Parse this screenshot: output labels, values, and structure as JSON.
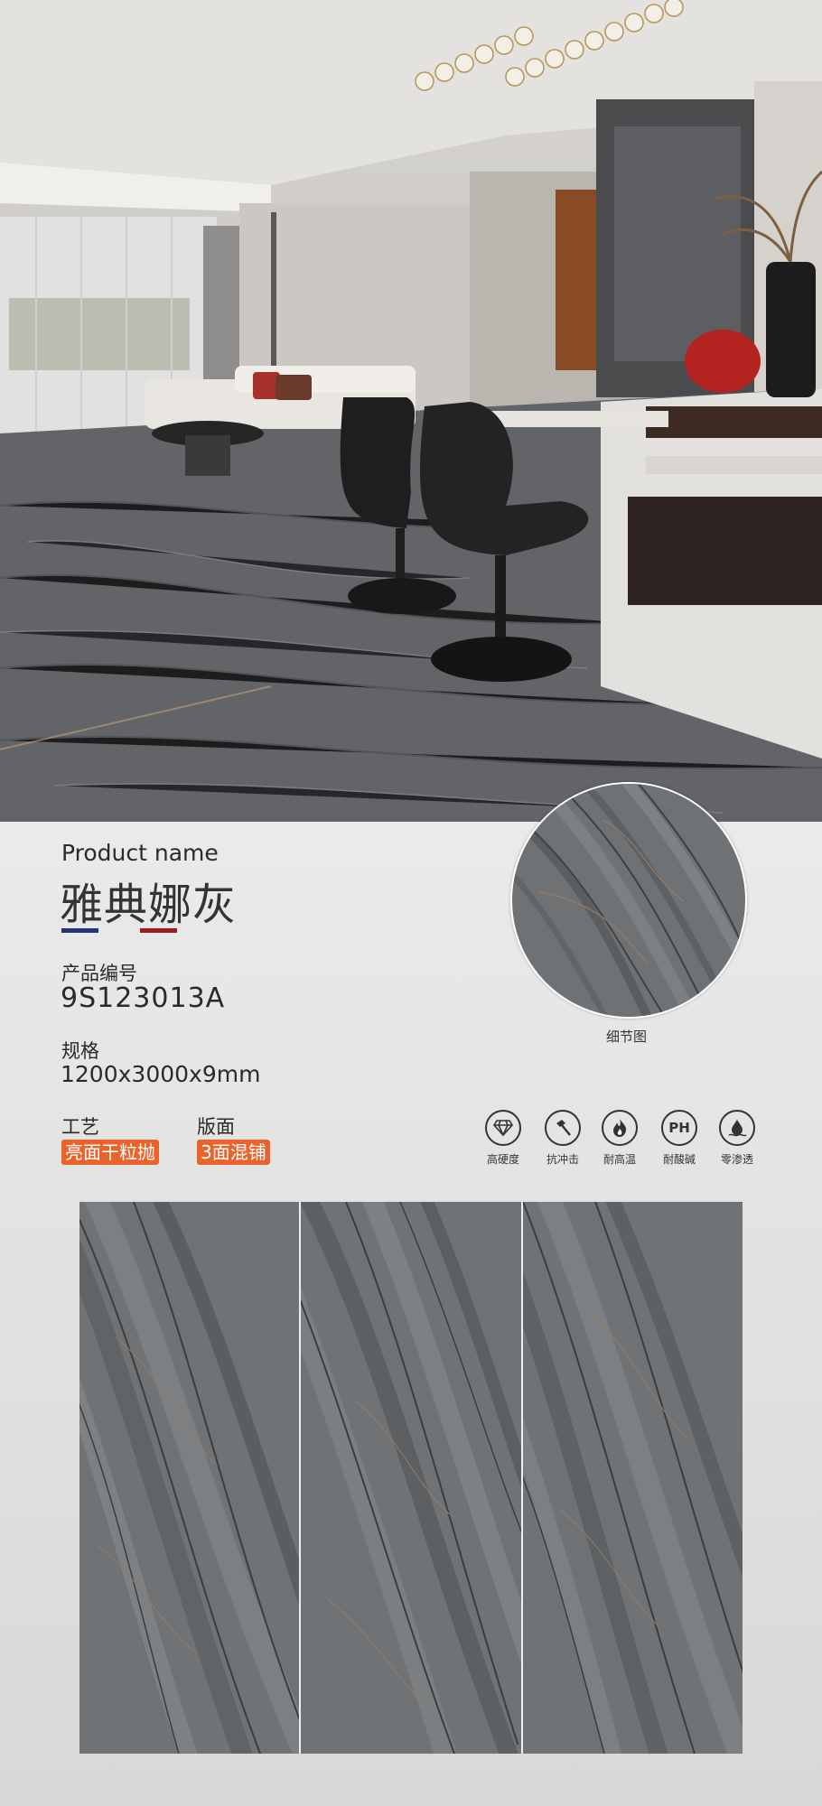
{
  "product": {
    "name_label": "Product name",
    "name": "雅典娜灰",
    "code_label": "产品编号",
    "code": "9S123013A",
    "spec_label": "规格",
    "spec": "1200x3000x9mm",
    "craft_label": "工艺",
    "craft": "亮面干粒抛",
    "face_label": "版面",
    "face": "3面混铺",
    "detail_label": "细节图"
  },
  "features": [
    {
      "icon": "diamond-icon",
      "label": "高硬度"
    },
    {
      "icon": "hammer-icon",
      "label": "抗冲击"
    },
    {
      "icon": "flame-icon",
      "label": "耐高温"
    },
    {
      "icon": "ph-icon",
      "label": "耐酸碱",
      "glyph": "PH"
    },
    {
      "icon": "water-drop-icon",
      "label": "零渗透"
    }
  ],
  "colors": {
    "accent": "#e9632b",
    "flag_blue": "#23367a",
    "flag_white": "#e8e8e8",
    "flag_red": "#9e1b22",
    "marble": "#6f7376"
  },
  "slabs": {
    "count": 3
  }
}
